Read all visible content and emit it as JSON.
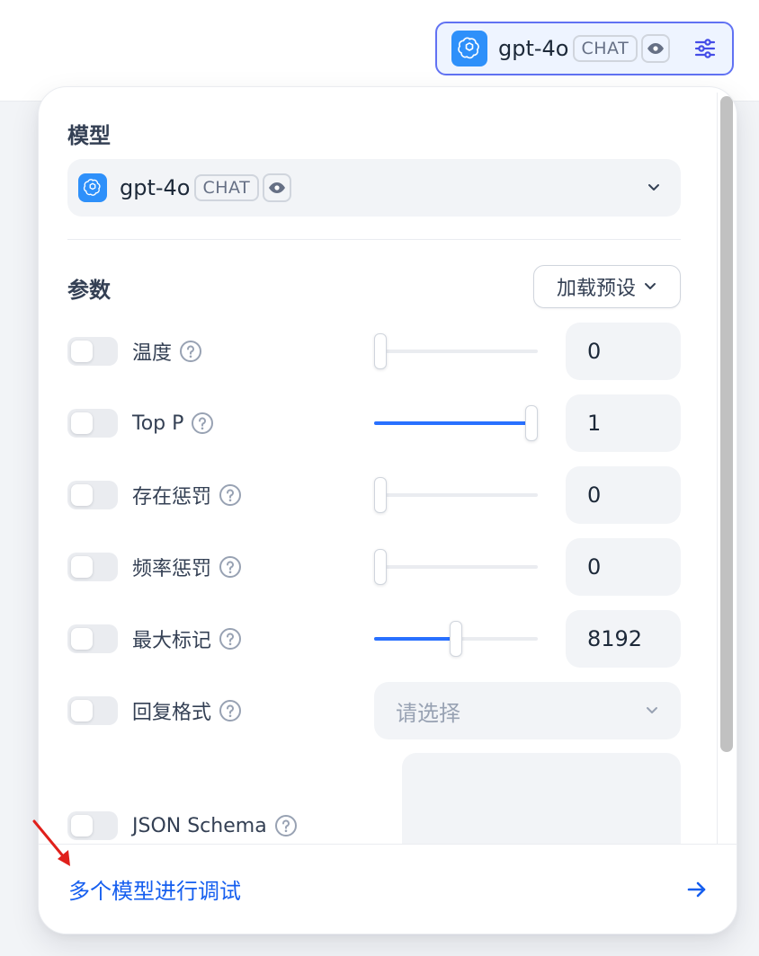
{
  "header": {
    "model": {
      "logo_icon": "openai-logo-icon",
      "name": "gpt-4o",
      "mode_badge": "CHAT",
      "vision_icon": "eye-icon",
      "settings_icon": "sliders-icon"
    }
  },
  "panel": {
    "model_section": {
      "label": "模型",
      "selected_model": "gpt-4o",
      "mode_badge": "CHAT",
      "chevron_icon": "chevron-down-icon"
    },
    "params_section": {
      "label": "参数",
      "preset_button": "加载预设"
    },
    "params": [
      {
        "label": "温度",
        "enabled": false,
        "value": "0",
        "slider_fraction": 0.0
      },
      {
        "label": "Top P",
        "enabled": false,
        "value": "1",
        "slider_fraction": 1.0
      },
      {
        "label": "存在惩罚",
        "enabled": false,
        "value": "0",
        "slider_fraction": 0.0
      },
      {
        "label": "频率惩罚",
        "enabled": false,
        "value": "0",
        "slider_fraction": 0.0
      },
      {
        "label": "最大标记",
        "enabled": false,
        "value": "8192",
        "slider_fraction": 0.5
      }
    ],
    "response_format": {
      "label": "回复格式",
      "enabled": false,
      "placeholder": "请选择"
    },
    "json_schema": {
      "label": "JSON Schema",
      "enabled": false
    },
    "footer": {
      "link_text": "多个模型进行调试",
      "arrow_icon": "arrow-right-icon"
    }
  },
  "colors": {
    "accent": "#155eef",
    "slider_fill": "#2970ff",
    "trigger_border": "#6172f3",
    "annotation": "#e0201b"
  }
}
